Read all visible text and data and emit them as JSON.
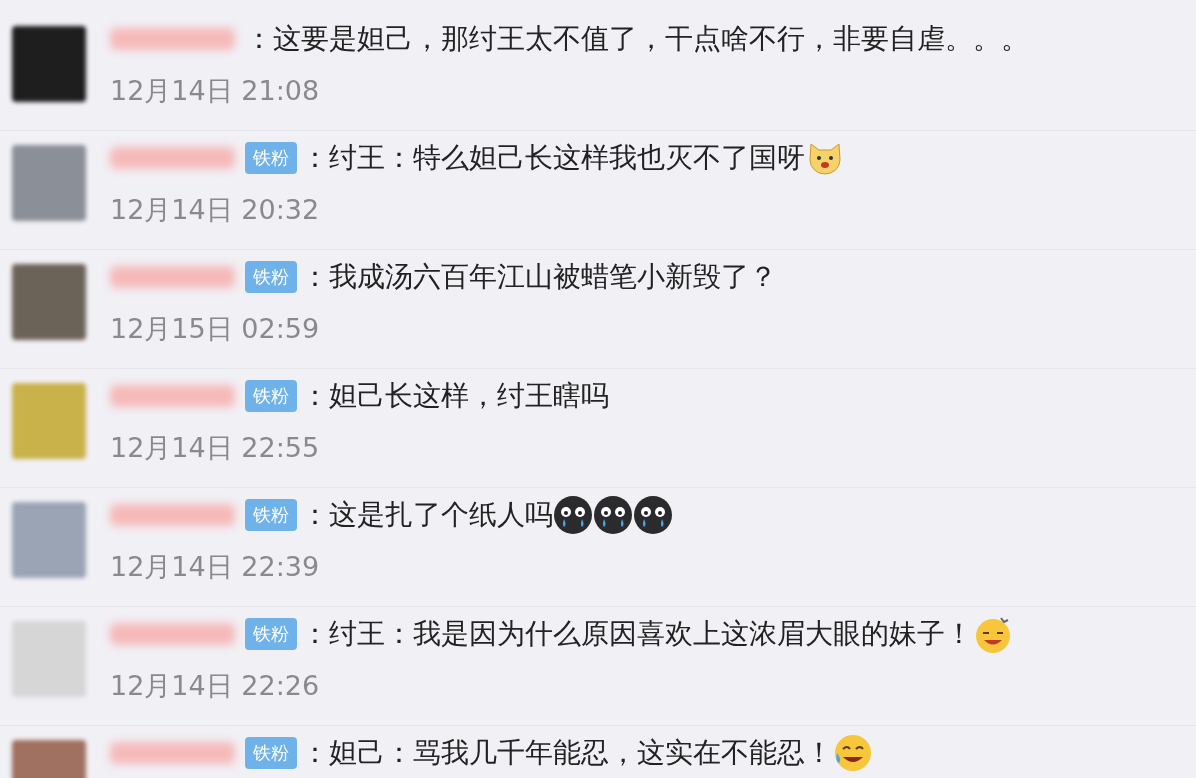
{
  "comments": [
    {
      "text": "：这要是妲己，那纣王太不值了，干点啥不行，非要自虐。。。",
      "time": "12月14日 21:08"
    },
    {
      "badge": "铁粉",
      "text": "：纣王：特么妲己长这样我也灭不了国呀",
      "emojis": [
        {
          "kind": "dog"
        }
      ],
      "time": "12月14日 20:32"
    },
    {
      "badge": "铁粉",
      "text": "：我成汤六百年江山被蜡笔小新毁了？",
      "time": "12月15日 02:59"
    },
    {
      "badge": "铁粉",
      "text": "：妲己长这样，纣王瞎吗",
      "time": "12月14日 22:55"
    },
    {
      "badge": "铁粉",
      "text": "：这是扎了个纸人吗",
      "emojis": [
        {
          "kind": "cry"
        },
        {
          "kind": "cry"
        },
        {
          "kind": "cry"
        }
      ],
      "time": "12月14日 22:39"
    },
    {
      "badge": "铁粉",
      "text": "：纣王：我是因为什么原因喜欢上这浓眉大眼的妹子！",
      "emojis": [
        {
          "kind": "dizzy-grin"
        }
      ],
      "time": "12月14日 22:26"
    },
    {
      "badge": "铁粉",
      "text": "：妲己：骂我几千年能忍，这实在不能忍！",
      "emojis": [
        {
          "kind": "laugh-cry"
        }
      ]
    }
  ]
}
